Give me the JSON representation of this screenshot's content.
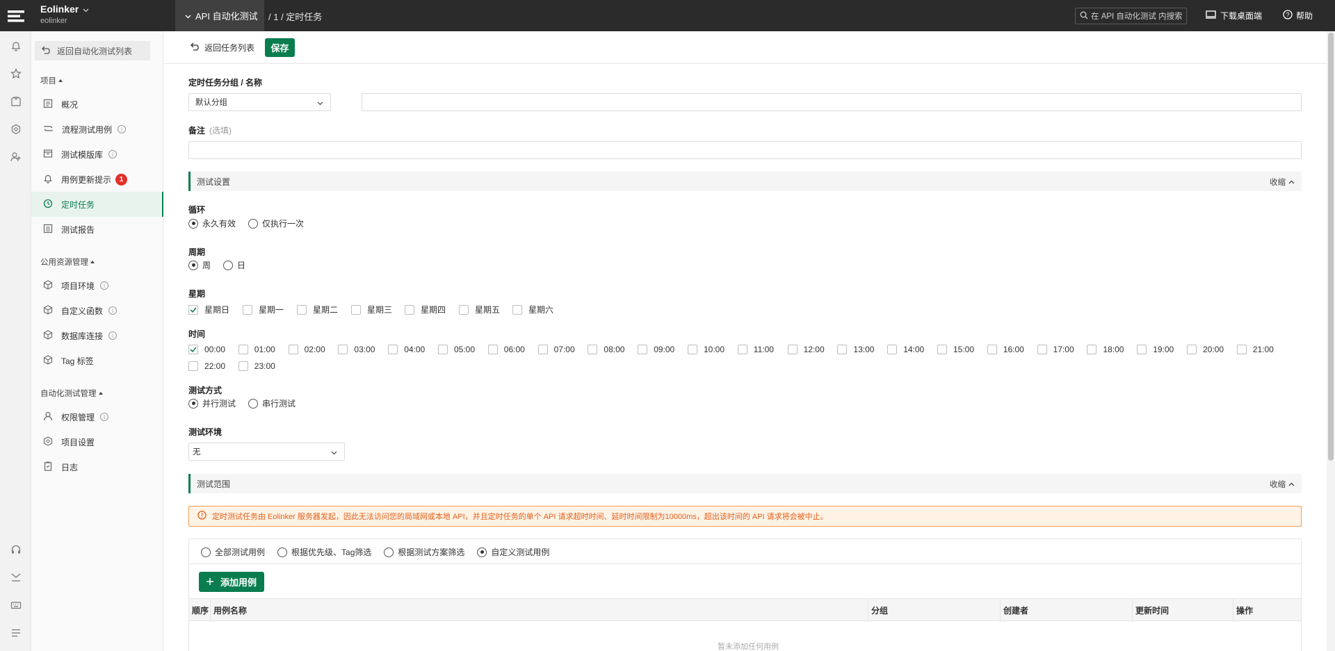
{
  "header": {
    "org_name": "Eolinker",
    "org_sub": "eolinker",
    "project_tab": "API 自动化测试",
    "breadcrumb": "/ 1 / 定时任务",
    "search_placeholder": "在 API 自动化测试 内搜索",
    "download_label": "下载桌面端",
    "help_label": "帮助"
  },
  "sidebar": {
    "back_label": "返回自动化测试列表",
    "groups": {
      "project": "项目",
      "public": "公用资源管理",
      "auto": "自动化测试管理"
    },
    "items": {
      "overview": "概况",
      "flow_cases": "流程测试用例",
      "template_lib": "测试模版库",
      "update_notice": "用例更新提示",
      "update_badge": "1",
      "scheduled": "定时任务",
      "report": "测试报告",
      "env": "项目环境",
      "func": "自定义函数",
      "db": "数据库连接",
      "tag": "Tag 标签",
      "perm": "权限管理",
      "settings": "项目设置",
      "log": "日志"
    }
  },
  "toolbar": {
    "back_label": "返回任务列表",
    "save_label": "保存"
  },
  "form": {
    "group_name_label": "定时任务分组 / 名称",
    "group_value": "默认分组",
    "name_value": "",
    "remark_label": "备注",
    "remark_optional": "(选填)",
    "remark_value": "",
    "test_settings_title": "测试设置",
    "collapse_label": "收缩",
    "loop_label": "循环",
    "loop_options": [
      "永久有效",
      "仅执行一次"
    ],
    "loop_selected": "永久有效",
    "period_label": "周期",
    "period_options": [
      "周",
      "日"
    ],
    "period_selected": "周",
    "week_label": "星期",
    "weekdays": [
      "星期日",
      "星期一",
      "星期二",
      "星期三",
      "星期四",
      "星期五",
      "星期六"
    ],
    "weekdays_checked": [
      "星期日"
    ],
    "time_label": "时间",
    "hours": [
      "00:00",
      "01:00",
      "02:00",
      "03:00",
      "04:00",
      "05:00",
      "06:00",
      "07:00",
      "08:00",
      "09:00",
      "10:00",
      "11:00",
      "12:00",
      "13:00",
      "14:00",
      "15:00",
      "16:00",
      "17:00",
      "18:00",
      "19:00",
      "20:00",
      "21:00",
      "22:00",
      "23:00"
    ],
    "hours_checked": [
      "00:00"
    ],
    "mode_label": "测试方式",
    "mode_options": [
      "并行测试",
      "串行测试"
    ],
    "mode_selected": "并行测试",
    "env_label": "测试环境",
    "env_value": "无",
    "scope_title": "测试范围",
    "alert_text": "定时测试任务由 Eolinker 服务器发起，因此无法访问您的局域网或本地 API，并且定时任务的单个 API 请求超时时间、延时时间限制为10000ms，超出该时间的 API 请求将会被中止。",
    "scope_options": [
      "全部测试用例",
      "根据优先级、Tag筛选",
      "根据测试方案筛选",
      "自定义测试用例"
    ],
    "scope_selected": "自定义测试用例",
    "add_case_label": "添加用例",
    "table_columns": [
      "顺序",
      "用例名称",
      "分组",
      "创建者",
      "更新时间",
      "操作"
    ],
    "empty_text": "暂未添加任何用例"
  },
  "colors": {
    "accent": "#0a7d4f",
    "topbar": "#2b2b2b",
    "badge": "#e2312b",
    "warning": "#e35f1a"
  }
}
